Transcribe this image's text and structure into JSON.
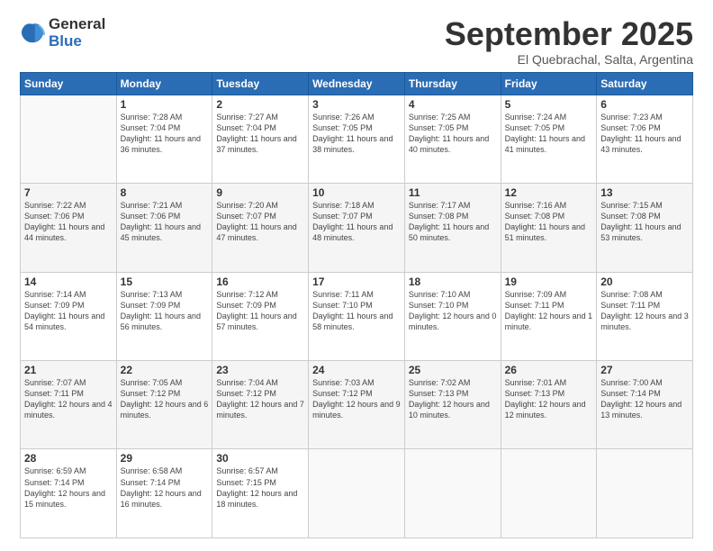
{
  "logo": {
    "general": "General",
    "blue": "Blue"
  },
  "header": {
    "month": "September 2025",
    "location": "El Quebrachal, Salta, Argentina"
  },
  "weekdays": [
    "Sunday",
    "Monday",
    "Tuesday",
    "Wednesday",
    "Thursday",
    "Friday",
    "Saturday"
  ],
  "days": [
    {
      "date": "",
      "sunrise": "",
      "sunset": "",
      "daylight": ""
    },
    {
      "date": "1",
      "sunrise": "Sunrise: 7:28 AM",
      "sunset": "Sunset: 7:04 PM",
      "daylight": "Daylight: 11 hours and 36 minutes."
    },
    {
      "date": "2",
      "sunrise": "Sunrise: 7:27 AM",
      "sunset": "Sunset: 7:04 PM",
      "daylight": "Daylight: 11 hours and 37 minutes."
    },
    {
      "date": "3",
      "sunrise": "Sunrise: 7:26 AM",
      "sunset": "Sunset: 7:05 PM",
      "daylight": "Daylight: 11 hours and 38 minutes."
    },
    {
      "date": "4",
      "sunrise": "Sunrise: 7:25 AM",
      "sunset": "Sunset: 7:05 PM",
      "daylight": "Daylight: 11 hours and 40 minutes."
    },
    {
      "date": "5",
      "sunrise": "Sunrise: 7:24 AM",
      "sunset": "Sunset: 7:05 PM",
      "daylight": "Daylight: 11 hours and 41 minutes."
    },
    {
      "date": "6",
      "sunrise": "Sunrise: 7:23 AM",
      "sunset": "Sunset: 7:06 PM",
      "daylight": "Daylight: 11 hours and 43 minutes."
    },
    {
      "date": "7",
      "sunrise": "Sunrise: 7:22 AM",
      "sunset": "Sunset: 7:06 PM",
      "daylight": "Daylight: 11 hours and 44 minutes."
    },
    {
      "date": "8",
      "sunrise": "Sunrise: 7:21 AM",
      "sunset": "Sunset: 7:06 PM",
      "daylight": "Daylight: 11 hours and 45 minutes."
    },
    {
      "date": "9",
      "sunrise": "Sunrise: 7:20 AM",
      "sunset": "Sunset: 7:07 PM",
      "daylight": "Daylight: 11 hours and 47 minutes."
    },
    {
      "date": "10",
      "sunrise": "Sunrise: 7:18 AM",
      "sunset": "Sunset: 7:07 PM",
      "daylight": "Daylight: 11 hours and 48 minutes."
    },
    {
      "date": "11",
      "sunrise": "Sunrise: 7:17 AM",
      "sunset": "Sunset: 7:08 PM",
      "daylight": "Daylight: 11 hours and 50 minutes."
    },
    {
      "date": "12",
      "sunrise": "Sunrise: 7:16 AM",
      "sunset": "Sunset: 7:08 PM",
      "daylight": "Daylight: 11 hours and 51 minutes."
    },
    {
      "date": "13",
      "sunrise": "Sunrise: 7:15 AM",
      "sunset": "Sunset: 7:08 PM",
      "daylight": "Daylight: 11 hours and 53 minutes."
    },
    {
      "date": "14",
      "sunrise": "Sunrise: 7:14 AM",
      "sunset": "Sunset: 7:09 PM",
      "daylight": "Daylight: 11 hours and 54 minutes."
    },
    {
      "date": "15",
      "sunrise": "Sunrise: 7:13 AM",
      "sunset": "Sunset: 7:09 PM",
      "daylight": "Daylight: 11 hours and 56 minutes."
    },
    {
      "date": "16",
      "sunrise": "Sunrise: 7:12 AM",
      "sunset": "Sunset: 7:09 PM",
      "daylight": "Daylight: 11 hours and 57 minutes."
    },
    {
      "date": "17",
      "sunrise": "Sunrise: 7:11 AM",
      "sunset": "Sunset: 7:10 PM",
      "daylight": "Daylight: 11 hours and 58 minutes."
    },
    {
      "date": "18",
      "sunrise": "Sunrise: 7:10 AM",
      "sunset": "Sunset: 7:10 PM",
      "daylight": "Daylight: 12 hours and 0 minutes."
    },
    {
      "date": "19",
      "sunrise": "Sunrise: 7:09 AM",
      "sunset": "Sunset: 7:11 PM",
      "daylight": "Daylight: 12 hours and 1 minute."
    },
    {
      "date": "20",
      "sunrise": "Sunrise: 7:08 AM",
      "sunset": "Sunset: 7:11 PM",
      "daylight": "Daylight: 12 hours and 3 minutes."
    },
    {
      "date": "21",
      "sunrise": "Sunrise: 7:07 AM",
      "sunset": "Sunset: 7:11 PM",
      "daylight": "Daylight: 12 hours and 4 minutes."
    },
    {
      "date": "22",
      "sunrise": "Sunrise: 7:05 AM",
      "sunset": "Sunset: 7:12 PM",
      "daylight": "Daylight: 12 hours and 6 minutes."
    },
    {
      "date": "23",
      "sunrise": "Sunrise: 7:04 AM",
      "sunset": "Sunset: 7:12 PM",
      "daylight": "Daylight: 12 hours and 7 minutes."
    },
    {
      "date": "24",
      "sunrise": "Sunrise: 7:03 AM",
      "sunset": "Sunset: 7:12 PM",
      "daylight": "Daylight: 12 hours and 9 minutes."
    },
    {
      "date": "25",
      "sunrise": "Sunrise: 7:02 AM",
      "sunset": "Sunset: 7:13 PM",
      "daylight": "Daylight: 12 hours and 10 minutes."
    },
    {
      "date": "26",
      "sunrise": "Sunrise: 7:01 AM",
      "sunset": "Sunset: 7:13 PM",
      "daylight": "Daylight: 12 hours and 12 minutes."
    },
    {
      "date": "27",
      "sunrise": "Sunrise: 7:00 AM",
      "sunset": "Sunset: 7:14 PM",
      "daylight": "Daylight: 12 hours and 13 minutes."
    },
    {
      "date": "28",
      "sunrise": "Sunrise: 6:59 AM",
      "sunset": "Sunset: 7:14 PM",
      "daylight": "Daylight: 12 hours and 15 minutes."
    },
    {
      "date": "29",
      "sunrise": "Sunrise: 6:58 AM",
      "sunset": "Sunset: 7:14 PM",
      "daylight": "Daylight: 12 hours and 16 minutes."
    },
    {
      "date": "30",
      "sunrise": "Sunrise: 6:57 AM",
      "sunset": "Sunset: 7:15 PM",
      "daylight": "Daylight: 12 hours and 18 minutes."
    }
  ]
}
